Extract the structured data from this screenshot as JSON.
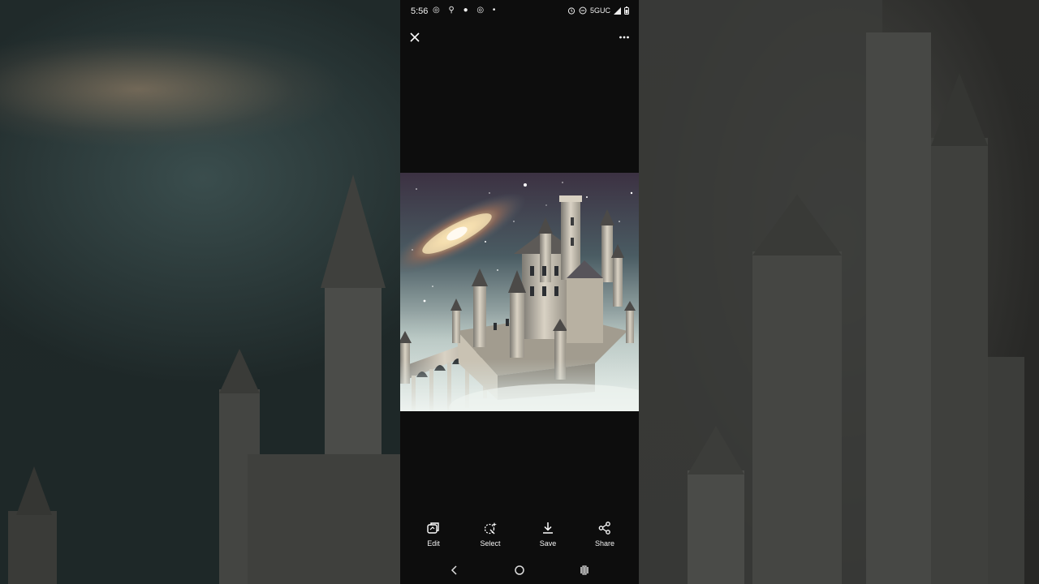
{
  "status_bar": {
    "time": "5:56",
    "left_icons": "◎ ⚲ ● ◎ •",
    "network": "5GUC"
  },
  "top_bar": {
    "close_icon": "close-icon",
    "more_icon": "more-vert-icon"
  },
  "actions": [
    {
      "label": "Edit",
      "icon": "edit-icon"
    },
    {
      "label": "Select",
      "icon": "select-icon"
    },
    {
      "label": "Save",
      "icon": "download-icon"
    },
    {
      "label": "Share",
      "icon": "share-icon"
    }
  ],
  "nav": {
    "back_icon": "back-icon",
    "home_icon": "home-icon",
    "recents_icon": "recents-icon"
  }
}
